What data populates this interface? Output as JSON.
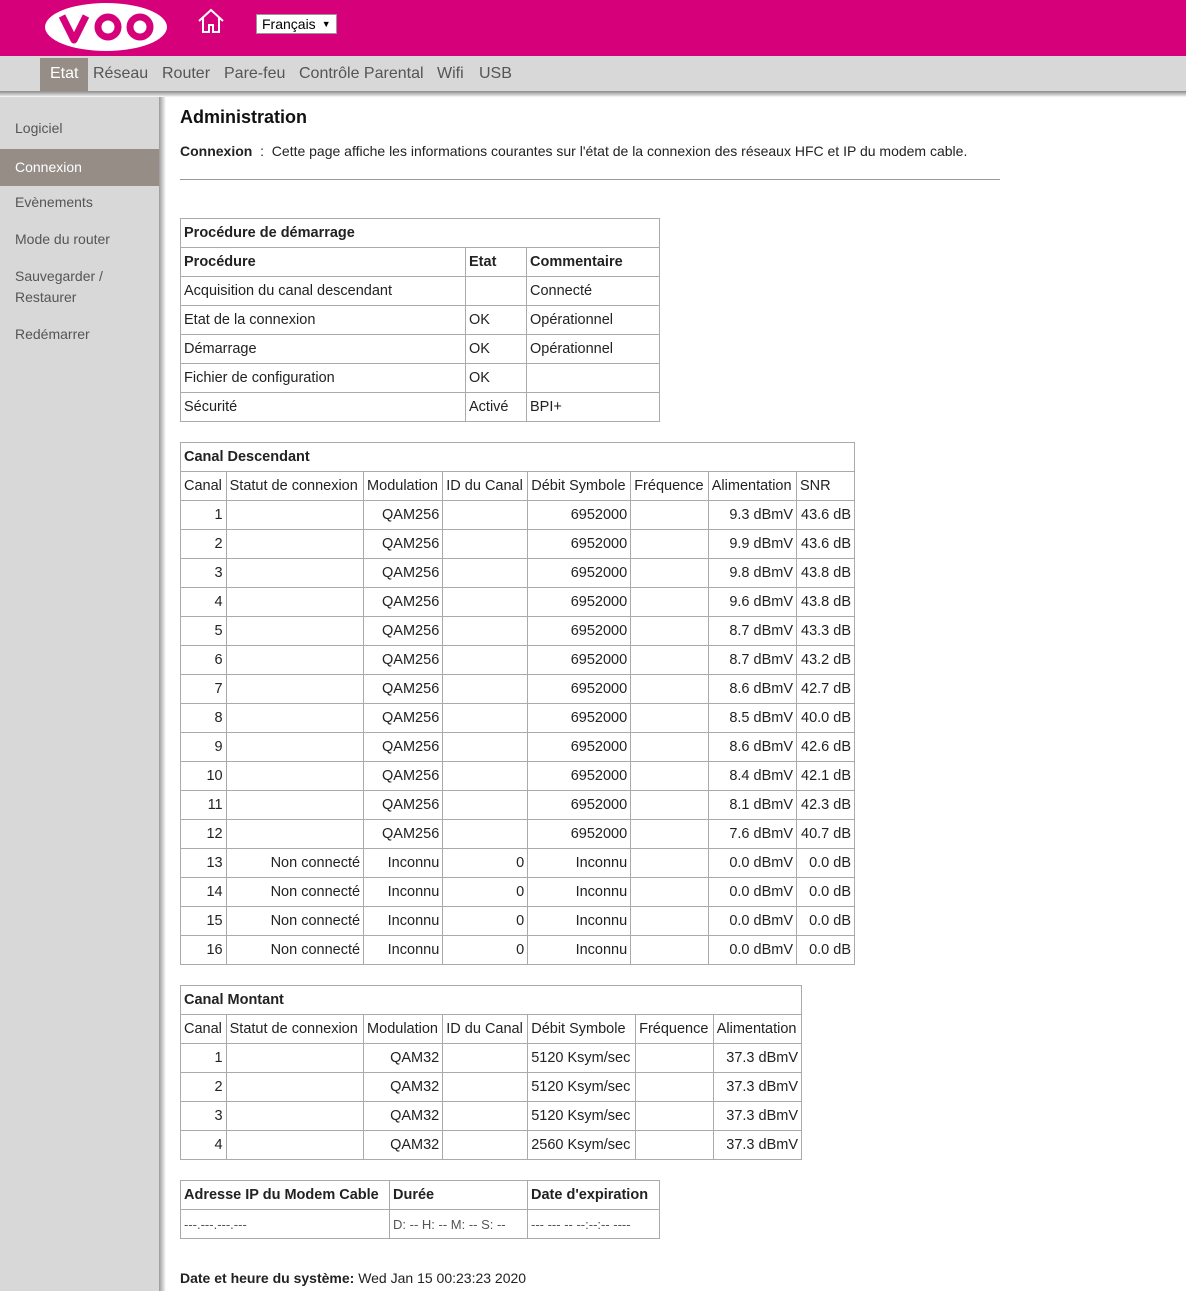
{
  "header": {
    "language": "Français",
    "brand_color": "#d6007a"
  },
  "topnav": {
    "tabs": [
      "Etat",
      "Réseau",
      "Router",
      "Pare-feu",
      "Contrôle Parental",
      "Wifi",
      "USB"
    ],
    "active": "Etat"
  },
  "sidebar": {
    "items": [
      "Logiciel",
      "Connexion",
      "Evènements",
      "Mode du router",
      "Sauvegarder /",
      "Restaurer",
      "Redémarrer"
    ],
    "active": "Connexion"
  },
  "main": {
    "title": "Administration",
    "desc_label": "Connexion",
    "desc_sep": ":",
    "desc_text": "Cette page affiche les informations courantes sur l'état de la connexion des réseaux HFC et IP du modem cable."
  },
  "startup": {
    "caption": "Procédure de démarrage",
    "headers": [
      "Procédure",
      "Etat",
      "Commentaire"
    ],
    "rows": [
      [
        "Acquisition du canal descendant",
        "",
        "Connecté"
      ],
      [
        "Etat de la connexion",
        "OK",
        "Opérationnel"
      ],
      [
        "Démarrage",
        "OK",
        "Opérationnel"
      ],
      [
        "Fichier de configuration",
        "OK",
        ""
      ],
      [
        "Sécurité",
        "Activé",
        "BPI+"
      ]
    ]
  },
  "downstream": {
    "caption": "Canal Descendant",
    "headers": [
      "Canal",
      "Statut de connexion",
      "Modulation",
      "ID du Canal",
      "Débit Symbole",
      "Fréquence",
      "Alimentation",
      "SNR"
    ],
    "rows": [
      [
        "1",
        "",
        "QAM256",
        "",
        "6952000",
        "",
        "9.3 dBmV",
        "43.6 dB"
      ],
      [
        "2",
        "",
        "QAM256",
        "",
        "6952000",
        "",
        "9.9 dBmV",
        "43.6 dB"
      ],
      [
        "3",
        "",
        "QAM256",
        "",
        "6952000",
        "",
        "9.8 dBmV",
        "43.8 dB"
      ],
      [
        "4",
        "",
        "QAM256",
        "",
        "6952000",
        "",
        "9.6 dBmV",
        "43.8 dB"
      ],
      [
        "5",
        "",
        "QAM256",
        "",
        "6952000",
        "",
        "8.7 dBmV",
        "43.3 dB"
      ],
      [
        "6",
        "",
        "QAM256",
        "",
        "6952000",
        "",
        "8.7 dBmV",
        "43.2 dB"
      ],
      [
        "7",
        "",
        "QAM256",
        "",
        "6952000",
        "",
        "8.6 dBmV",
        "42.7 dB"
      ],
      [
        "8",
        "",
        "QAM256",
        "",
        "6952000",
        "",
        "8.5 dBmV",
        "40.0 dB"
      ],
      [
        "9",
        "",
        "QAM256",
        "",
        "6952000",
        "",
        "8.6 dBmV",
        "42.6 dB"
      ],
      [
        "10",
        "",
        "QAM256",
        "",
        "6952000",
        "",
        "8.4 dBmV",
        "42.1 dB"
      ],
      [
        "11",
        "",
        "QAM256",
        "",
        "6952000",
        "",
        "8.1 dBmV",
        "42.3 dB"
      ],
      [
        "12",
        "",
        "QAM256",
        "",
        "6952000",
        "",
        "7.6 dBmV",
        "40.7 dB"
      ],
      [
        "13",
        "Non connecté",
        "Inconnu",
        "0",
        "Inconnu",
        "",
        "0.0 dBmV",
        "0.0 dB"
      ],
      [
        "14",
        "Non connecté",
        "Inconnu",
        "0",
        "Inconnu",
        "",
        "0.0 dBmV",
        "0.0 dB"
      ],
      [
        "15",
        "Non connecté",
        "Inconnu",
        "0",
        "Inconnu",
        "",
        "0.0 dBmV",
        "0.0 dB"
      ],
      [
        "16",
        "Non connecté",
        "Inconnu",
        "0",
        "Inconnu",
        "",
        "0.0 dBmV",
        "0.0 dB"
      ]
    ]
  },
  "upstream": {
    "caption": "Canal Montant",
    "headers": [
      "Canal",
      "Statut de connexion",
      "Modulation",
      "ID du Canal",
      "Débit Symbole",
      "Fréquence",
      "Alimentation"
    ],
    "rows": [
      [
        "1",
        "",
        "QAM32",
        "",
        "5120 Ksym/sec",
        "",
        "37.3 dBmV"
      ],
      [
        "2",
        "",
        "QAM32",
        "",
        "5120 Ksym/sec",
        "",
        "37.3 dBmV"
      ],
      [
        "3",
        "",
        "QAM32",
        "",
        "5120 Ksym/sec",
        "",
        "37.3 dBmV"
      ],
      [
        "4",
        "",
        "QAM32",
        "",
        "2560 Ksym/sec",
        "",
        "37.3 dBmV"
      ]
    ]
  },
  "ip": {
    "headers": [
      "Adresse IP du Modem Cable",
      "Durée",
      "Date d'expiration"
    ],
    "row": [
      "---.---.---.---",
      "D: -- H: -- M: -- S: --",
      "--- --- -- --:--:-- ----"
    ]
  },
  "footer": {
    "label": "Date et heure du système:",
    "value": "Wed Jan 15 00:23:23 2020"
  }
}
